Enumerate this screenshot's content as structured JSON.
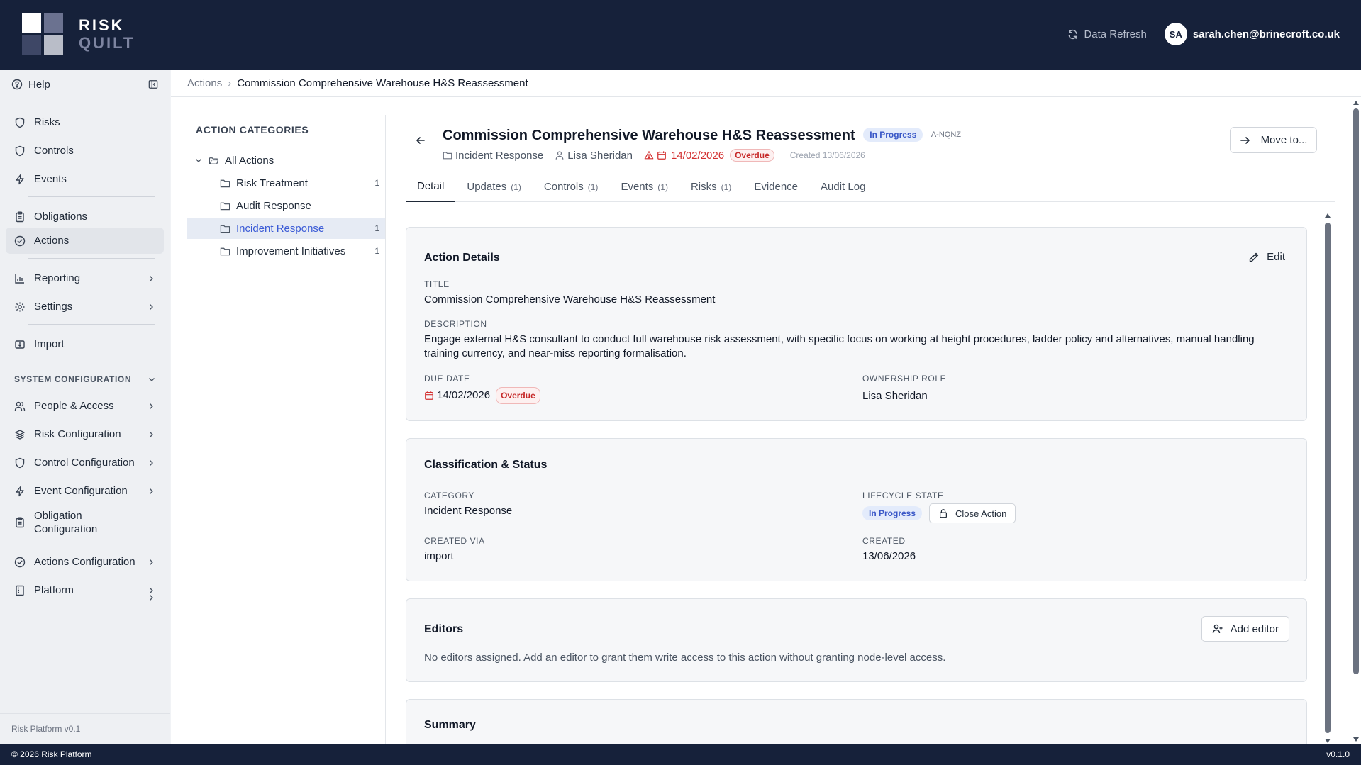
{
  "app": {
    "logo_line1": "RISK",
    "logo_line2": "QUILT",
    "data_refresh": "Data Refresh",
    "user_initials": "SA",
    "user_email": "sarah.chen@brinecroft.co.uk"
  },
  "sidebar": {
    "help": "Help",
    "items": [
      {
        "label": "Risks",
        "icon": "shield-icon"
      },
      {
        "label": "Controls",
        "icon": "shield-icon"
      },
      {
        "label": "Events",
        "icon": "bolt-icon"
      },
      {
        "label": "Obligations",
        "icon": "clipboard-icon"
      },
      {
        "label": "Actions",
        "icon": "check-circle-icon"
      },
      {
        "label": "Reporting",
        "icon": "bar-chart-icon"
      },
      {
        "label": "Settings",
        "icon": "gear-icon"
      },
      {
        "label": "Import",
        "icon": "import-icon"
      }
    ],
    "section_title": "SYSTEM CONFIGURATION",
    "config_items": [
      {
        "label": "People & Access",
        "icon": "users-icon"
      },
      {
        "label": "Risk Configuration",
        "icon": "layers-icon"
      },
      {
        "label": "Control Configuration",
        "icon": "shield-icon"
      },
      {
        "label": "Event Configuration",
        "icon": "bolt-icon"
      },
      {
        "label": "Obligation Configuration",
        "icon": "clipboard-icon"
      },
      {
        "label": "Actions Configuration",
        "icon": "check-circle-icon"
      },
      {
        "label": "Platform",
        "icon": "building-icon"
      }
    ],
    "footer": "Risk Platform v0.1"
  },
  "footer": {
    "copyright": "© 2026 Risk Platform",
    "version": "v0.1.0"
  },
  "breadcrumb": {
    "parent": "Actions",
    "current": "Commission Comprehensive Warehouse H&S Reassessment"
  },
  "categories": {
    "title": "ACTION CATEGORIES",
    "root": "All Actions",
    "items": [
      {
        "label": "Risk Treatment",
        "count": "1"
      },
      {
        "label": "Audit Response",
        "count": ""
      },
      {
        "label": "Incident Response",
        "count": "1"
      },
      {
        "label": "Improvement Initiatives",
        "count": "1"
      }
    ]
  },
  "header": {
    "title": "Commission Comprehensive Warehouse H&S Reassessment",
    "status": "In Progress",
    "id": "A-NQNZ",
    "category": "Incident Response",
    "owner": "Lisa Sheridan",
    "due": "14/02/2026",
    "overdue": "Overdue",
    "created": "Created 13/06/2026",
    "move_to": "Move to..."
  },
  "tabs": [
    {
      "label": "Detail",
      "count": ""
    },
    {
      "label": "Updates",
      "count": "(1)"
    },
    {
      "label": "Controls",
      "count": "(1)"
    },
    {
      "label": "Events",
      "count": "(1)"
    },
    {
      "label": "Risks",
      "count": "(1)"
    },
    {
      "label": "Evidence",
      "count": ""
    },
    {
      "label": "Audit Log",
      "count": ""
    }
  ],
  "details": {
    "title": "Action Details",
    "edit": "Edit",
    "title_label": "TITLE",
    "title_value": "Commission Comprehensive Warehouse H&S Reassessment",
    "desc_label": "DESCRIPTION",
    "desc_value": "Engage external H&S consultant to conduct full warehouse risk assessment, with specific focus on working at height procedures, ladder policy and alternatives, manual handling training currency, and near-miss reporting formalisation.",
    "due_label": "DUE DATE",
    "due_value": "14/02/2026",
    "overdue": "Overdue",
    "owner_label": "OWNERSHIP ROLE",
    "owner_value": "Lisa Sheridan"
  },
  "classification": {
    "title": "Classification & Status",
    "category_label": "CATEGORY",
    "category_value": "Incident Response",
    "lifecycle_label": "LIFECYCLE STATE",
    "lifecycle_value": "In Progress",
    "close_action": "Close Action",
    "created_via_label": "CREATED VIA",
    "created_via_value": "import",
    "created_label": "CREATED",
    "created_value": "13/06/2026"
  },
  "editors": {
    "title": "Editors",
    "add": "Add editor",
    "empty": "No editors assigned. Add an editor to grant them write access to this action without granting node-level access."
  },
  "summary": {
    "title": "Summary"
  }
}
